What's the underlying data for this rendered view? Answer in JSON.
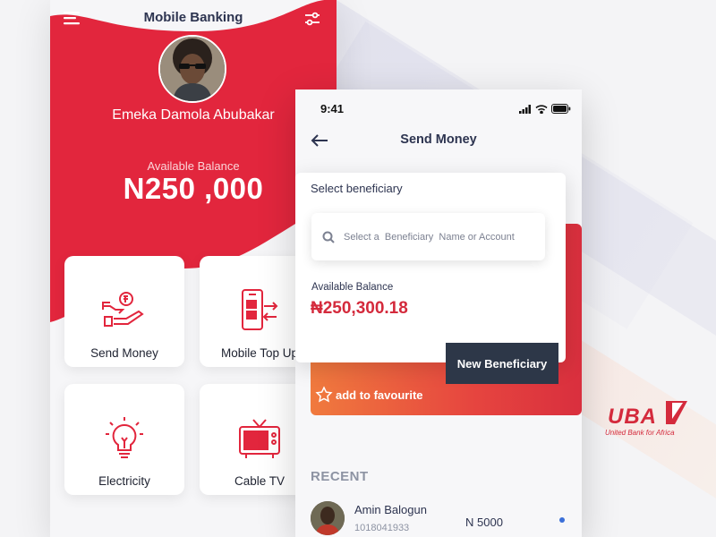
{
  "colors": {
    "accent_red": "#e2263d",
    "dark_navy": "#2d3748",
    "page_bg": "#f4f4f6"
  },
  "left_phone": {
    "title": "Mobile Banking",
    "menu_icon": "hamburger-menu-icon",
    "filter_icon": "sliders-icon",
    "user_name": "Emeka Damola Abubakar",
    "balance_label": "Available Balance",
    "balance_value": "N250 ,000",
    "tiles": [
      {
        "label": "Send Money",
        "icon": "hand-money-icon"
      },
      {
        "label": "Mobile Top Up",
        "icon": "phone-topup-icon"
      },
      {
        "label": "Electricity",
        "icon": "lightbulb-icon"
      },
      {
        "label": "Cable TV",
        "icon": "tv-icon"
      }
    ]
  },
  "right_phone": {
    "status_time": "9:41",
    "title": "Send Money",
    "back_icon": "arrow-left-icon",
    "card": {
      "title": "Select beneficiary",
      "search_placeholder": "Select a  Beneficiary  Name or Account",
      "balance_label": "Available Balance",
      "balance_value": "₦250,300.18"
    },
    "new_beneficiary_button": "New Beneficiary",
    "favourite_label": "add to favourite",
    "recent_heading": "RECENT",
    "recent": [
      {
        "name": "Amin Balogun",
        "account": "1018041933",
        "amount": "N 5000"
      }
    ]
  },
  "logo": {
    "text": "UBA",
    "subtitle": "United Bank for Africa"
  }
}
